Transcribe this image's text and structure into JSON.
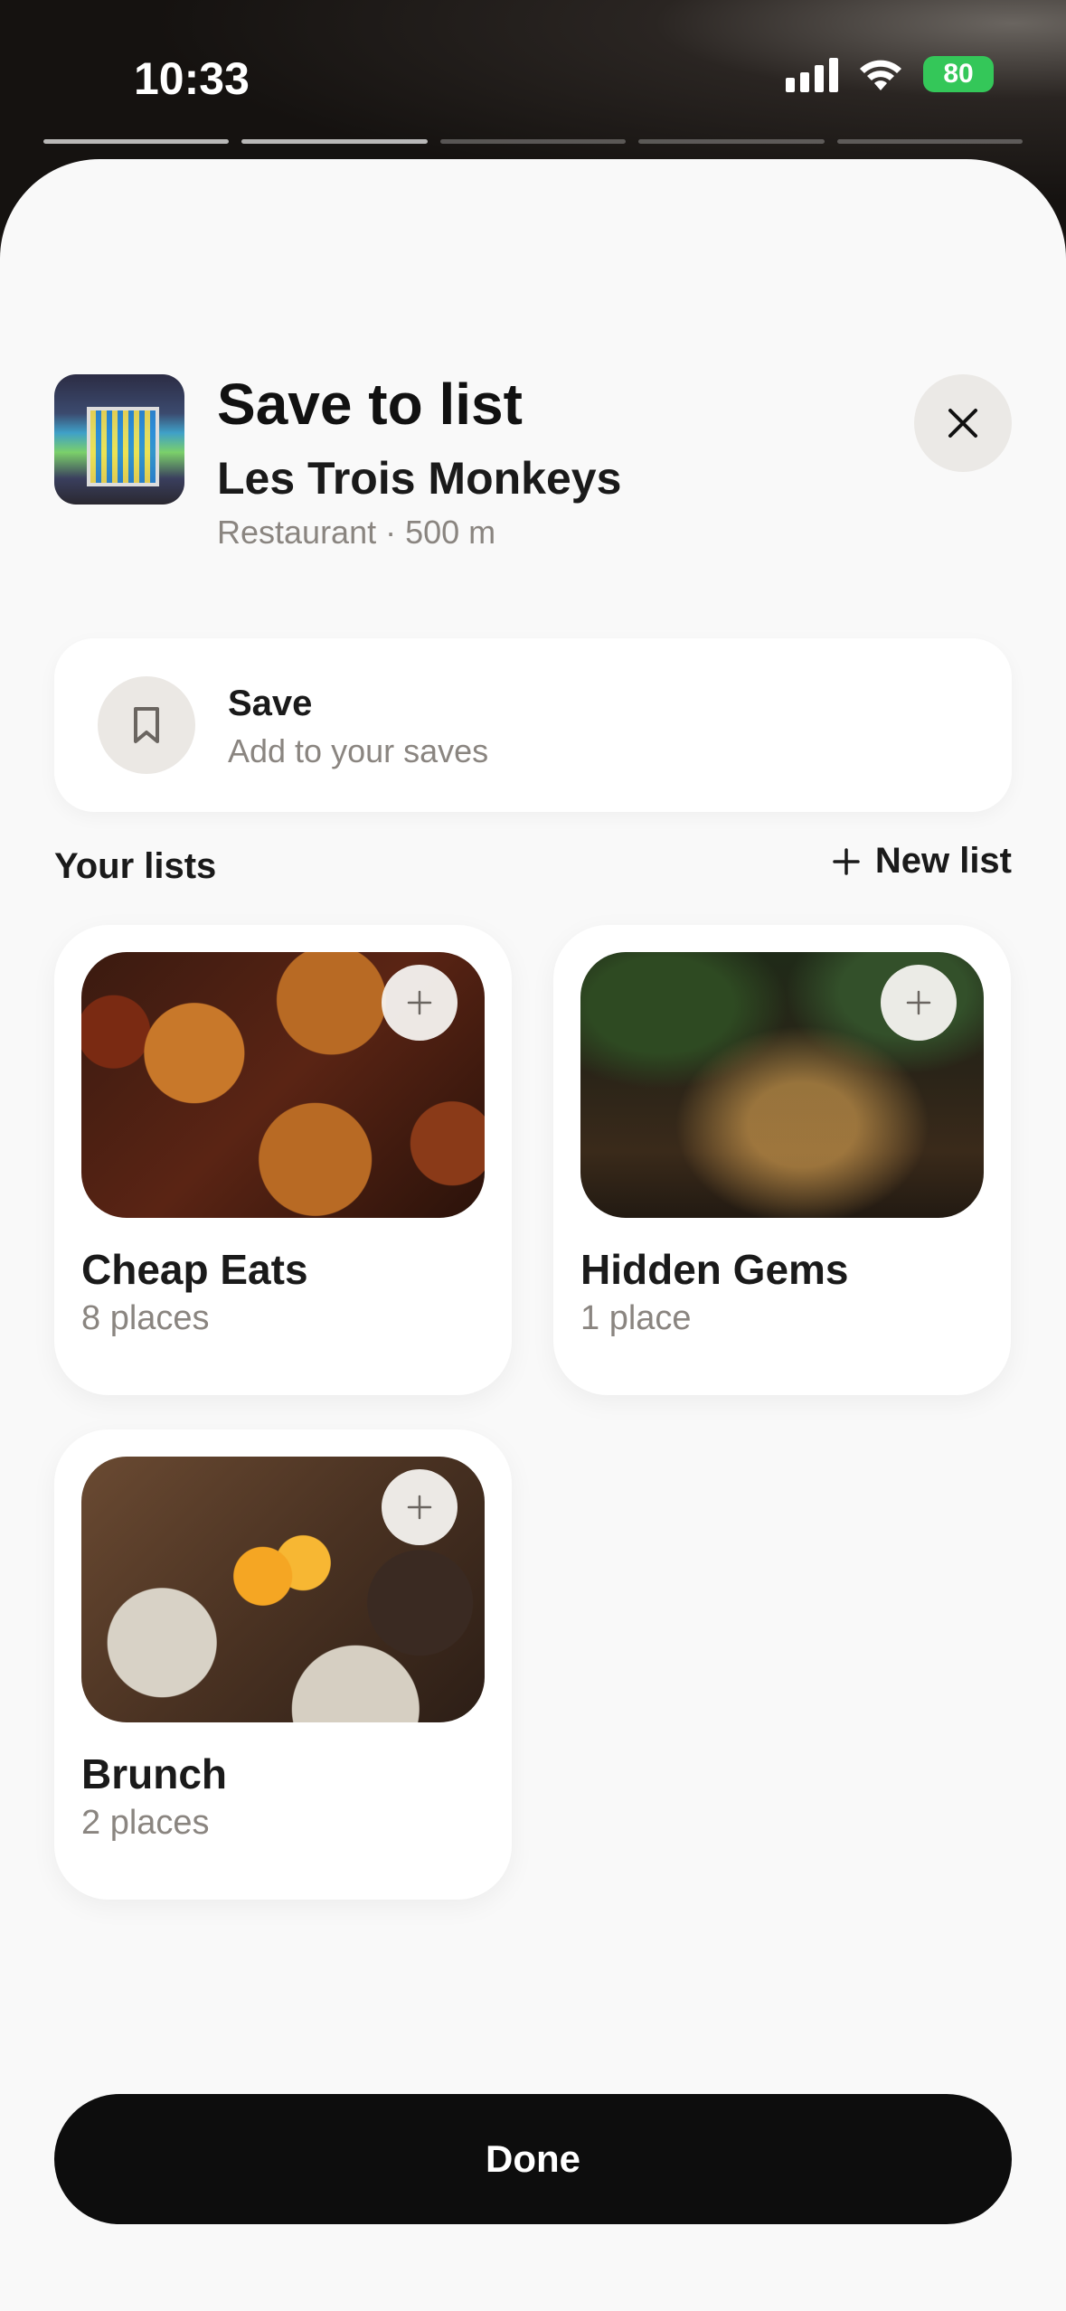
{
  "status_bar": {
    "time": "10:33",
    "battery": "80"
  },
  "header": {
    "title": "Save to list",
    "place_name": "Les Trois Monkeys",
    "place_meta": "Restaurant · 500 m"
  },
  "save_option": {
    "title": "Save",
    "subtitle": "Add to your saves"
  },
  "lists_section": {
    "title": "Your lists",
    "new_list_label": "New list"
  },
  "lists": [
    {
      "name": "Cheap Eats",
      "count": "8 places"
    },
    {
      "name": "Hidden Gems",
      "count": "1 place"
    },
    {
      "name": "Brunch",
      "count": "2 places"
    }
  ],
  "footer": {
    "done_label": "Done"
  }
}
